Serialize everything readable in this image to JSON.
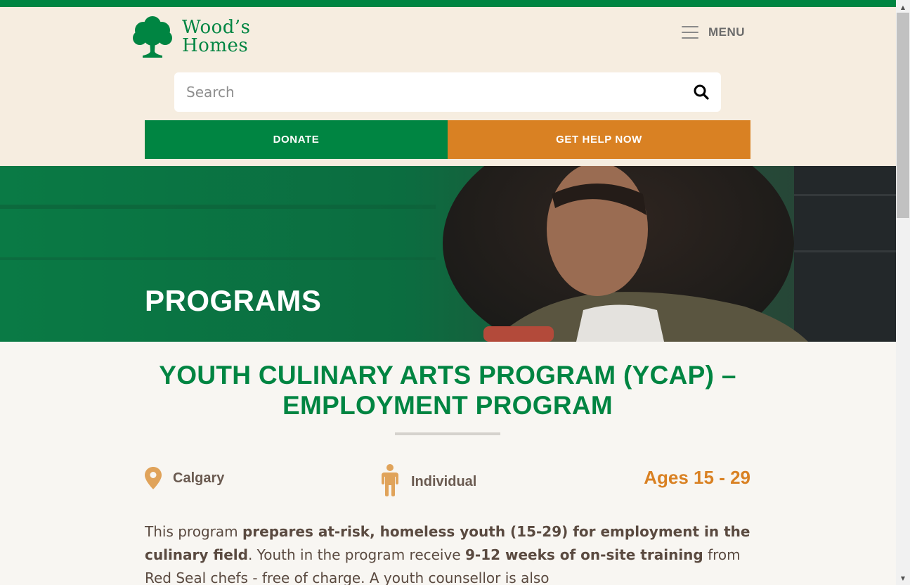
{
  "brand": {
    "line1": "Wood’s",
    "line2": "Homes",
    "primary": "#008542",
    "accent": "#d98123"
  },
  "header": {
    "menu_label": "MENU",
    "search": {
      "placeholder": "Search"
    },
    "donate_label": "DONATE",
    "help_label": "GET HELP NOW"
  },
  "hero": {
    "title": "PROGRAMS"
  },
  "program": {
    "title": "YOUTH CULINARY ARTS PROGRAM (YCAP) – EMPLOYMENT PROGRAM",
    "location": "Calgary",
    "audience": "Individual",
    "ages": "Ages 15 - 29",
    "description": [
      {
        "text": "This program ",
        "bold": false
      },
      {
        "text": "prepares at-risk, homeless youth (15-29) for employment in the culinary field",
        "bold": true
      },
      {
        "text": ". Youth in the program receive ",
        "bold": false
      },
      {
        "text": "9-12 weeks of on-site training",
        "bold": true
      },
      {
        "text": " from Red Seal chefs - free of charge. A youth counsellor is also",
        "bold": false
      }
    ]
  },
  "icons": {
    "logo": "tree-icon",
    "menu": "hamburger-icon",
    "search": "search-icon",
    "location": "map-pin-icon",
    "audience": "person-icon"
  }
}
